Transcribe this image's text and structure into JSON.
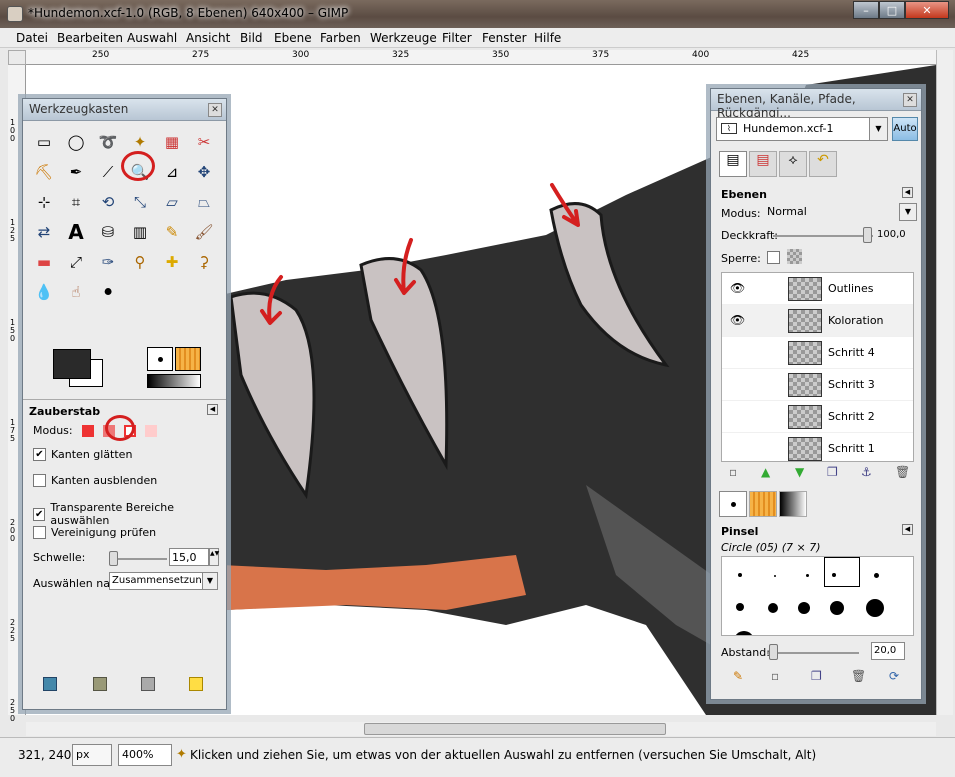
{
  "window": {
    "title": "*Hundemon.xcf-1.0 (RGB, 8 Ebenen) 640x400 – GIMP",
    "controls": [
      "–",
      "□",
      "✕"
    ]
  },
  "menu": [
    "Datei",
    "Bearbeiten",
    "Auswahl",
    "Ansicht",
    "Bild",
    "Ebene",
    "Farben",
    "Werkzeuge",
    "Filter",
    "Fenster",
    "Hilfe"
  ],
  "ruler": {
    "h_ticks": [
      "250",
      "275",
      "300",
      "325",
      "350",
      "375",
      "400",
      "425"
    ],
    "v_ticks": [
      "1 0 0",
      "1 2 5",
      "1 5 0",
      "1 7 5",
      "2 0 0",
      "2 2 5",
      "2 5 0"
    ]
  },
  "toolbox": {
    "title": "Werkzeugkasten",
    "close": "✕",
    "tool_options_title": "Zauberstab",
    "mode_label": "Modus:",
    "options": [
      {
        "label": "Kanten glätten",
        "checked": true
      },
      {
        "label": "Kanten ausblenden",
        "checked": false
      },
      {
        "label": "Transparente Bereiche auswählen",
        "checked": true
      },
      {
        "label": "Vereinigung prüfen",
        "checked": false
      }
    ],
    "threshold_label": "Schwelle:",
    "threshold_value": "15,0",
    "select_by_label": "Auswählen nach:",
    "select_by_value": "Zusammensetzung"
  },
  "layers_dock": {
    "title": "Ebenen, Kanäle, Pfade, Rückgängi...",
    "close": "✕",
    "image_select": "Hundemon.xcf-1",
    "auto_label": "Auto",
    "section_title": "Ebenen",
    "mode_label": "Modus:",
    "mode_value": "Normal",
    "opacity_label": "Deckkraft:",
    "opacity_value": "100,0",
    "lock_label": "Sperre:",
    "layers": [
      {
        "name": "Outlines",
        "visible": true
      },
      {
        "name": "Koloration",
        "visible": true
      },
      {
        "name": "Schritt 4",
        "visible": false
      },
      {
        "name": "Schritt 3",
        "visible": false
      },
      {
        "name": "Schritt 2",
        "visible": false
      },
      {
        "name": "Schritt 1",
        "visible": false
      }
    ],
    "brushes_title": "Pinsel",
    "brush_name": "Circle (05) (7 × 7)",
    "spacing_label": "Abstand:",
    "spacing_value": "20,0"
  },
  "status": {
    "coords": "321, 240",
    "unit": "px",
    "zoom": "400%",
    "message": "Klicken und ziehen Sie, um etwas von der aktuellen Auswahl zu entfernen (versuchen Sie Umschalt, Alt)"
  },
  "colors": {
    "titlebar": "#5b4c43",
    "dog_body": "#2f2f2f",
    "tooth": "#c9c2c2",
    "stripe": "#d8744a",
    "annotation": "#d41f1f"
  }
}
